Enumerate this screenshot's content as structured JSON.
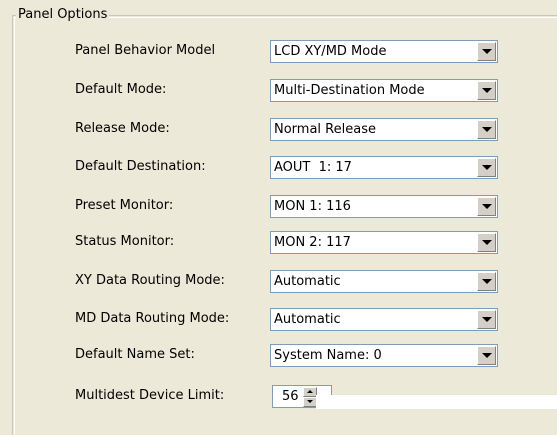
{
  "panel": {
    "title": "Panel Options"
  },
  "fields": [
    {
      "label": "Panel Behavior Model",
      "value": "LCD XY/MD Mode"
    },
    {
      "label": "Default Mode:",
      "value": "Multi-Destination Mode"
    },
    {
      "label": "Release Mode:",
      "value": "Normal Release"
    },
    {
      "label": "Default Destination:",
      "value": "AOUT  1: 17"
    },
    {
      "label": "Preset Monitor:",
      "value": "MON 1: 116"
    },
    {
      "label": "Status Monitor:",
      "value": "MON 2: 117"
    },
    {
      "label": "XY Data Routing Mode:",
      "value": "Automatic"
    },
    {
      "label": "MD Data Routing Mode:",
      "value": "Automatic"
    },
    {
      "label": "Default Name Set:",
      "value": "System Name: 0"
    }
  ],
  "multidest": {
    "label": "Multidest Device Limit:",
    "value": "56"
  },
  "icons": {
    "dropdown": "chevron-down-icon",
    "spin_up": "spin-up-icon",
    "spin_down": "spin-down-icon"
  },
  "colors": {
    "background": "#ece9d8",
    "field_border": "#7f9db9",
    "button_face": "#d4d0c8"
  }
}
